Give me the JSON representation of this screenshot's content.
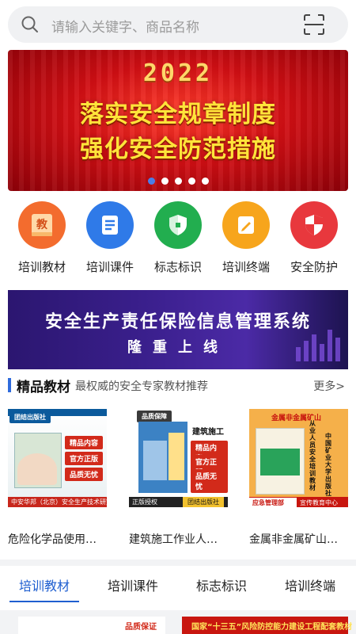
{
  "search": {
    "placeholder": "请输入关键字、商品名称"
  },
  "banner": {
    "year": "2022",
    "line1": "落实安全规章制度",
    "line2": "强化安全防范措施",
    "dots_total": 5,
    "active_dot": 1
  },
  "categories": [
    {
      "label": "培训教材",
      "icon": "book-icon",
      "glyph": "教",
      "color": "#f36c2e"
    },
    {
      "label": "培训课件",
      "icon": "document-icon",
      "color": "#2f7ae8"
    },
    {
      "label": "标志标识",
      "icon": "shield-icon",
      "color": "#22ae4f"
    },
    {
      "label": "培训终端",
      "icon": "pen-icon",
      "color": "#f7a51c"
    },
    {
      "label": "安全防护",
      "icon": "shield-icon",
      "color": "#e8383d"
    }
  ],
  "promo": {
    "line1": "安全生产责任保险信息管理系统",
    "line2": "隆重上线"
  },
  "featured": {
    "title": "精品教材",
    "subtitle": "最权威的安全专家教材推荐",
    "more": "更多>"
  },
  "books": [
    {
      "title": "危险化学品使用…",
      "publisher_badge": "团结出版社",
      "tags": [
        "精品内容",
        "官方正版",
        "品质无忧"
      ],
      "footer": "中安华邦（北京）安全生产技术研究院 编"
    },
    {
      "title": "建筑施工作业人…",
      "top_badge": "品质保障",
      "cover_title": "建筑施工",
      "tags": [
        "精品内容",
        "官方正版",
        "品质无忧"
      ],
      "footer_left": "正版授权",
      "footer_right": "团结出版社"
    },
    {
      "title": "金属非金属矿山…",
      "top_badge": "金属非金属矿山",
      "side_text_1": "从业人员安全培训教材",
      "side_text_2": "中国矿业大学出版社",
      "footer_left": "应急管理部",
      "footer_right": "宣传教育中心 编"
    }
  ],
  "tabs": [
    {
      "label": "培训教材",
      "active": true
    },
    {
      "label": "培训课件",
      "active": false
    },
    {
      "label": "标志标识",
      "active": false
    },
    {
      "label": "培训终端",
      "active": false
    }
  ],
  "bottom_cards": {
    "card_a_badge": "品质保证",
    "card_b_text": "国家“十三五”风险防控能力建设工程配套教材"
  }
}
